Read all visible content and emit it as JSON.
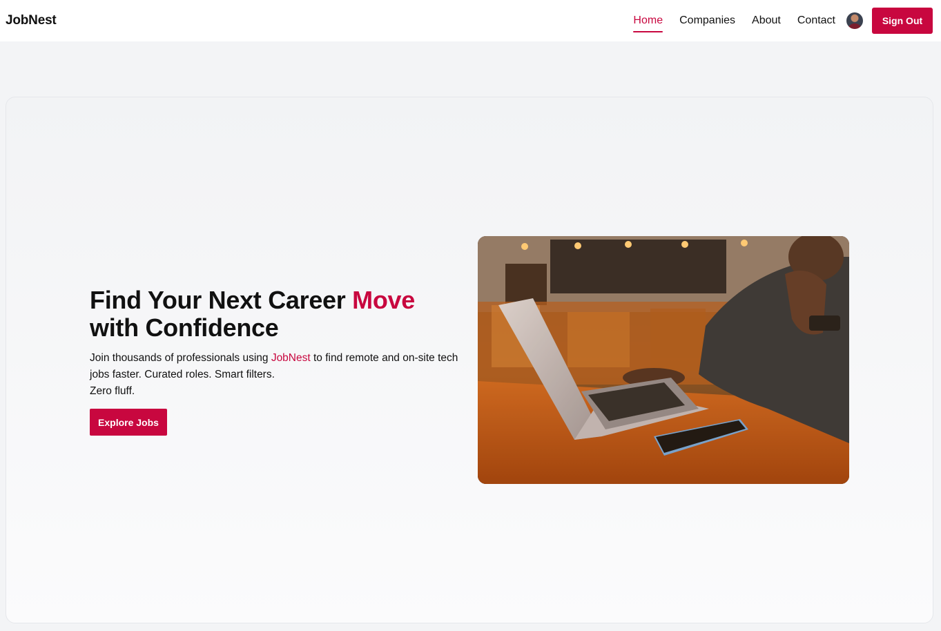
{
  "nav": {
    "brand": "JobNest",
    "links": [
      {
        "label": "Home",
        "active": true
      },
      {
        "label": "Companies",
        "active": false
      },
      {
        "label": "About",
        "active": false
      },
      {
        "label": "Contact",
        "active": false
      }
    ],
    "sign_out_label": "Sign Out"
  },
  "hero": {
    "headline_part1": "Find Your Next Career ",
    "headline_accent": "Move",
    "headline_part2": "with Confidence",
    "subtitle_part1": "Join thousands of professionals using ",
    "subtitle_brand": "JobNest",
    "subtitle_part2": " to find remote and on-site tech jobs faster. Curated roles. Smart filters.",
    "subtitle_part3": "Zero fluff.",
    "cta_label": "Explore Jobs"
  },
  "colors": {
    "accent": "#c8073f",
    "page_background": "#f3f4f6",
    "navbar_background": "#ffffff"
  },
  "icons": {
    "avatar": "user-avatar"
  }
}
